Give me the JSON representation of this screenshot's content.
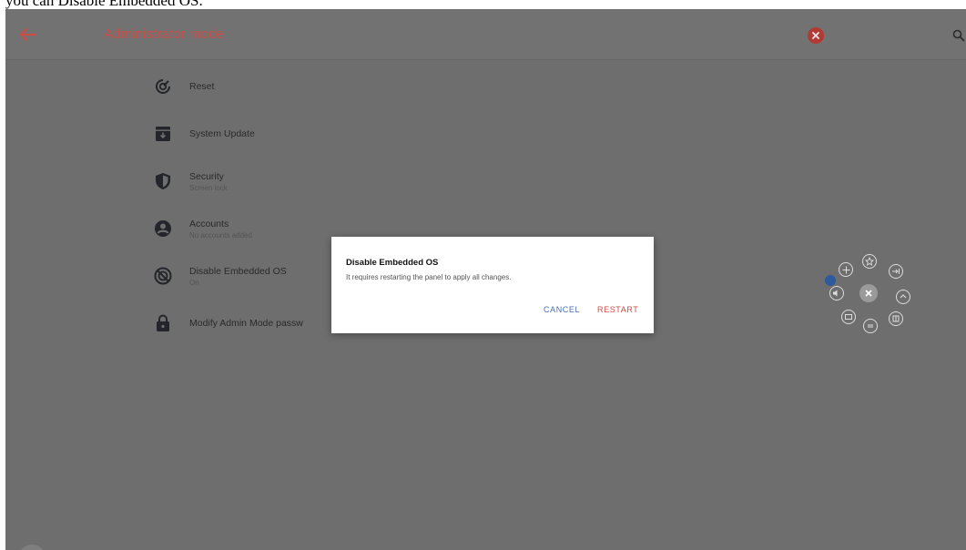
{
  "caption": "you can Disable Embedded OS.",
  "appbar": {
    "title": "Administrator mode"
  },
  "settings": {
    "items": [
      {
        "title": "Reset",
        "subtitle": ""
      },
      {
        "title": "System Update",
        "subtitle": ""
      },
      {
        "title": "Security",
        "subtitle": "Screen lock"
      },
      {
        "title": "Accounts",
        "subtitle": "No accounts added"
      },
      {
        "title": "Disable Embedded OS",
        "subtitle": "On"
      },
      {
        "title": "Modify Admin Mode passw",
        "subtitle": ""
      }
    ]
  },
  "dialog": {
    "title": "Disable Embedded OS",
    "message": "It requires restarting the panel to apply all changes.",
    "cancel_label": "CANCEL",
    "restart_label": "RESTART"
  },
  "colors": {
    "accent": "#c94e47",
    "restart": "#d24a42",
    "cancel": "#4a6fb5",
    "screen_bg": "#6e6e6e",
    "icon_dark": "#23252a"
  },
  "icons": {
    "back": "arrow-left-icon",
    "close": "close-circle-icon",
    "search": "search-icon",
    "reset": "reset-icon",
    "system_update": "system-update-icon",
    "security": "shield-icon",
    "accounts": "account-circle-icon",
    "disable_os": "disable-os-icon",
    "lock": "lock-icon"
  }
}
